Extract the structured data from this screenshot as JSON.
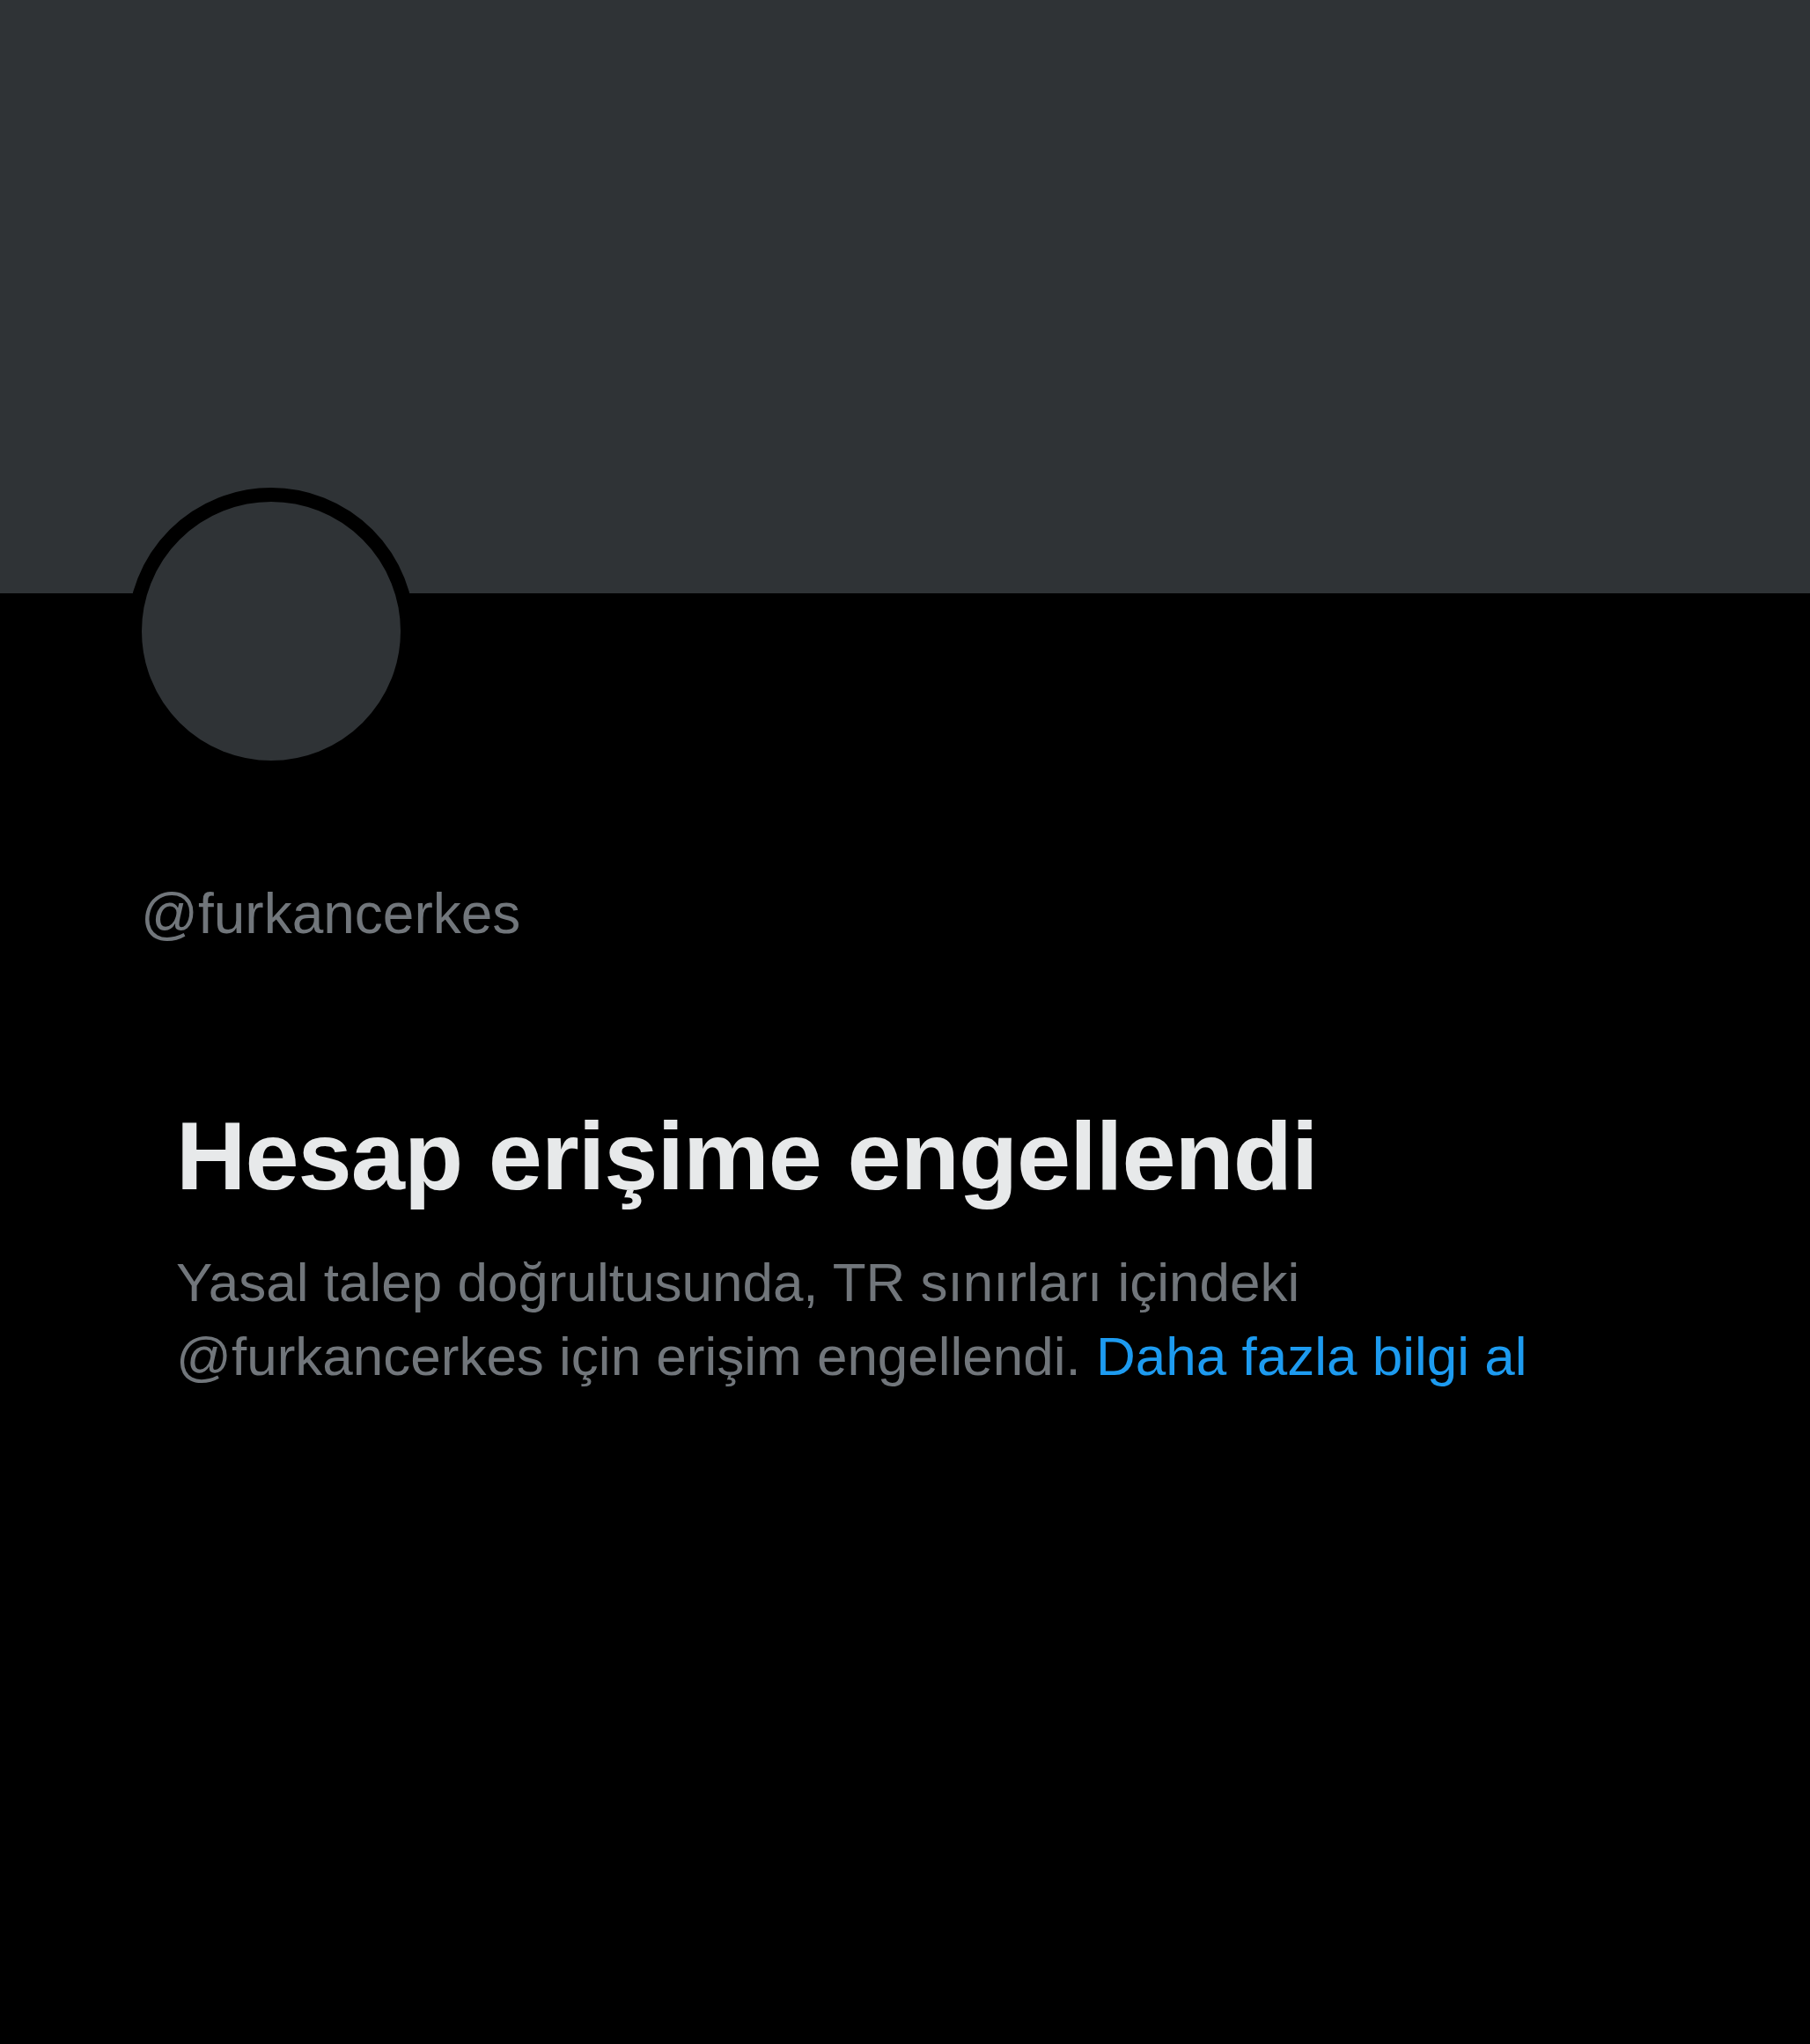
{
  "profile": {
    "handle": "@furkancerkes"
  },
  "notice": {
    "title": "Hesap erişime engellendi",
    "message": "Yasal talep doğrultusunda, TR sınırları içindeki @furkancerkes için erişim engellendi.",
    "link": "Daha fazla bilgi al"
  }
}
